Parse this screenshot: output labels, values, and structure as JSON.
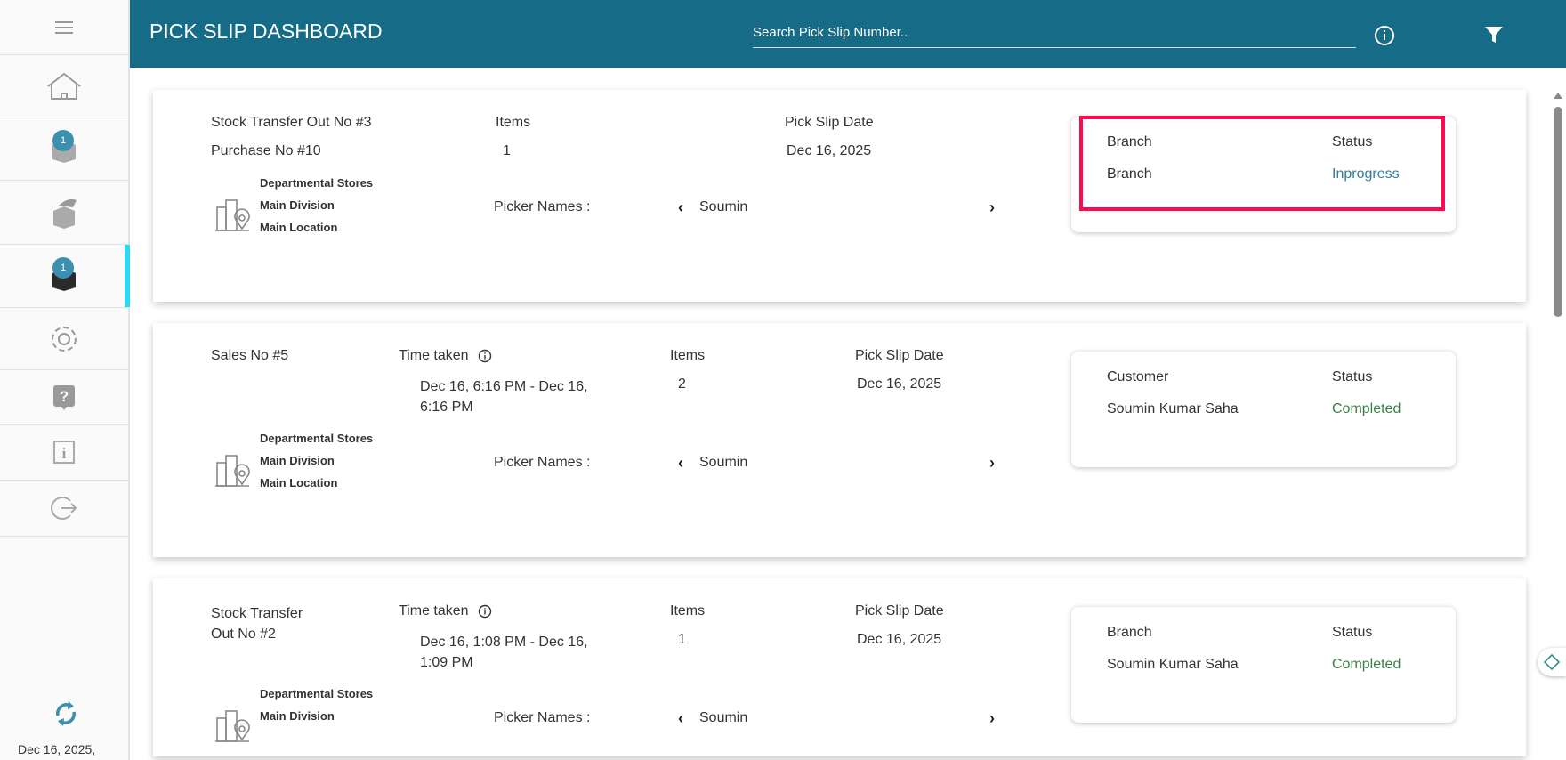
{
  "sidebar": {
    "sync_date": "Dec 16, 2025,",
    "badges": [
      "1",
      "1"
    ]
  },
  "header": {
    "title": "PICK SLIP DASHBOARD",
    "search_placeholder": "Search Pick Slip Number.."
  },
  "cards": [
    {
      "ref1": "Stock Transfer Out No #3",
      "ref2": "Purchase No #10",
      "items_label": "Items",
      "items": "1",
      "date_label": "Pick Slip Date",
      "date": "Dec 16, 2025",
      "org": [
        "Departmental Stores",
        "Main Division",
        "Main Location"
      ],
      "picker_label": "Picker Names :",
      "picker": "Soumin",
      "party_label": "Branch",
      "party": "Branch",
      "status_label": "Status",
      "status": "Inprogress"
    },
    {
      "ref1": "Sales No #5",
      "time_label": "Time taken",
      "time": "Dec 16, 6:16 PM - Dec 16, 6:16 PM",
      "items_label": "Items",
      "items": "2",
      "date_label": "Pick Slip Date",
      "date": "Dec 16, 2025",
      "org": [
        "Departmental Stores",
        "Main Division",
        "Main Location"
      ],
      "picker_label": "Picker Names :",
      "picker": "Soumin",
      "party_label": "Customer",
      "party": "Soumin Kumar Saha",
      "status_label": "Status",
      "status": "Completed"
    },
    {
      "ref1": "Stock Transfer Out No #2",
      "time_label": "Time taken",
      "time": "Dec 16, 1:08 PM - Dec 16, 1:09 PM",
      "items_label": "Items",
      "items": "1",
      "date_label": "Pick Slip Date",
      "date": "Dec 16, 2025",
      "org": [
        "Departmental Stores",
        "Main Division"
      ],
      "picker_label": "Picker Names :",
      "picker": "Soumin",
      "party_label": "Branch",
      "party": "Soumin Kumar Saha",
      "status_label": "Status",
      "status": "Completed"
    }
  ],
  "colors": {
    "header": "#166b87",
    "inprogress": "#2f7f9e",
    "completed": "#3a7d44",
    "highlight": "#ff0a4e"
  }
}
